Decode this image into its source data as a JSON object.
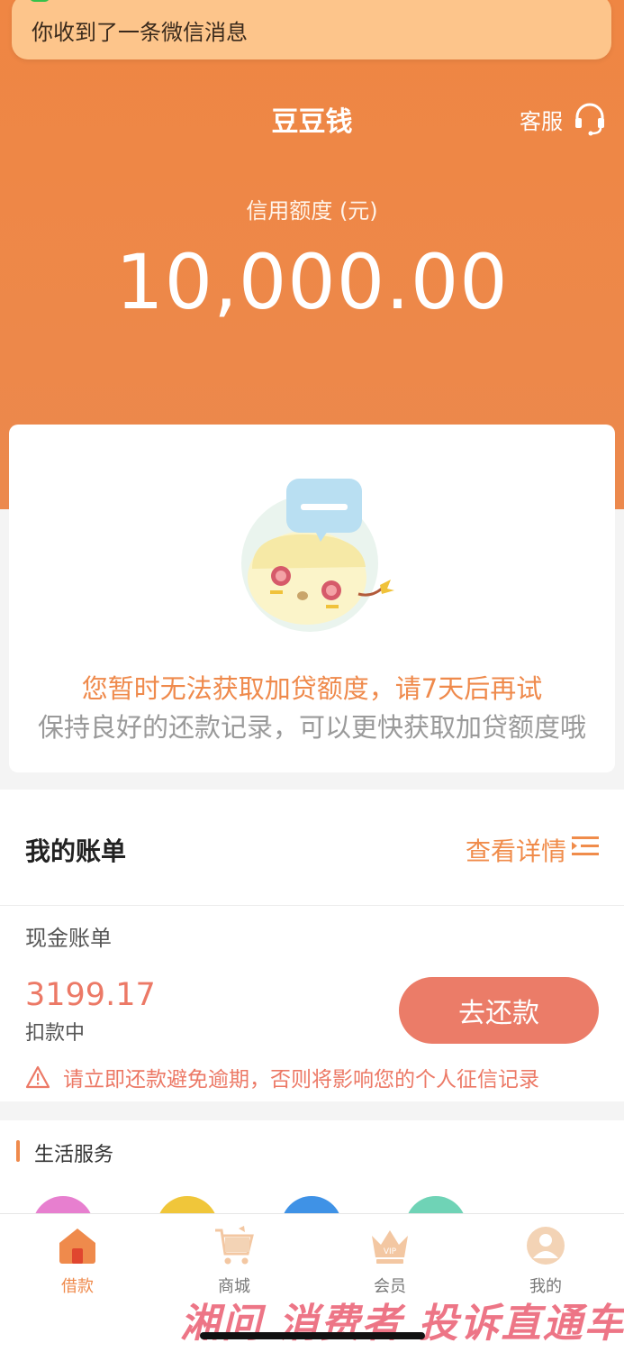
{
  "notification": {
    "text": "你收到了一条微信消息"
  },
  "header": {
    "title": "豆豆钱",
    "customer_service": "客服"
  },
  "credit": {
    "label": "信用额度 (元)",
    "amount": "10,000.00"
  },
  "status_card": {
    "message_primary": "您暂时无法获取加贷额度，请7天后再试",
    "message_secondary": "保持良好的还款记录，可以更快获取加贷额度哦"
  },
  "bill": {
    "title": "我的账单",
    "view_details": "查看详情",
    "subtitle": "现金账单",
    "amount": "3199.17",
    "status": "扣款中",
    "repay_button": "去还款",
    "warning": "请立即还款避免逾期，否则将影响您的个人征信记录"
  },
  "life_services": {
    "title": "生活服务"
  },
  "tabs": [
    {
      "label": "借款",
      "icon": "home-icon",
      "active": true
    },
    {
      "label": "商城",
      "icon": "cart-icon",
      "active": false
    },
    {
      "label": "会员",
      "icon": "crown-icon",
      "active": false
    },
    {
      "label": "我的",
      "icon": "user-icon",
      "active": false
    }
  ],
  "watermark": {
    "text": "湘问 消费者 投诉直通车"
  },
  "colors": {
    "accent": "#ef8a4c",
    "repay": "#eb7c68",
    "warning": "#ec7966"
  }
}
